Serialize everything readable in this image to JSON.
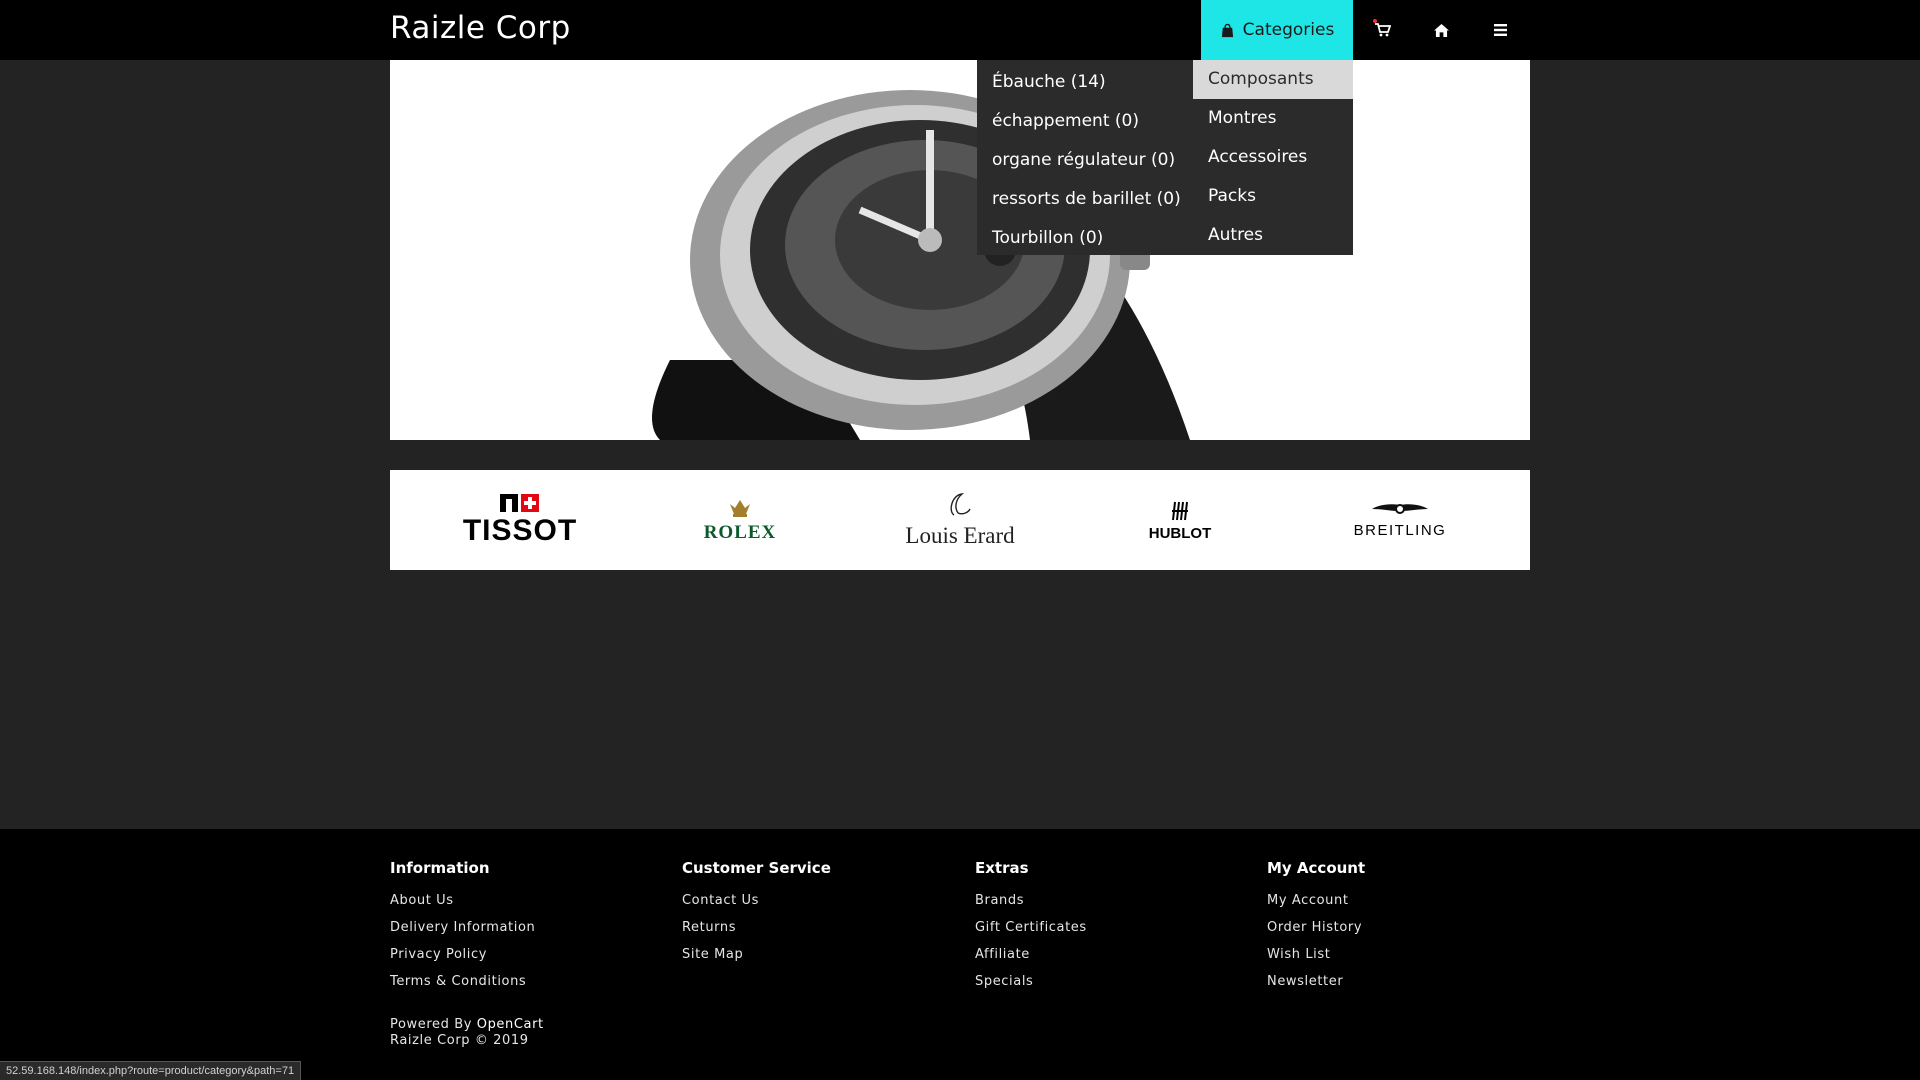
{
  "header": {
    "brand": "Raizle Corp",
    "categories_label": "Categories",
    "accent_color": "#1ee6e6"
  },
  "dropdown": {
    "main_items": [
      "Composants",
      "Montres",
      "Accessoires",
      "Packs",
      "Autres"
    ],
    "sub_items": [
      "Ébauche (14)",
      "échappement (0)",
      "organe régulateur (0)",
      "ressorts de barillet (0)",
      "Tourbillon (0)"
    ]
  },
  "brands": [
    "TISSOT",
    "ROLEX",
    "Louis Erard",
    "HUBLOT",
    "BREITLING"
  ],
  "footer": {
    "columns": [
      {
        "title": "Information",
        "links": [
          "About Us",
          "Delivery Information",
          "Privacy Policy",
          "Terms & Conditions"
        ]
      },
      {
        "title": "Customer Service",
        "links": [
          "Contact Us",
          "Returns",
          "Site Map"
        ]
      },
      {
        "title": "Extras",
        "links": [
          "Brands",
          "Gift Certificates",
          "Affiliate",
          "Specials"
        ]
      },
      {
        "title": "My Account",
        "links": [
          "My Account",
          "Order History",
          "Wish List",
          "Newsletter"
        ]
      }
    ],
    "powered_prefix": "Powered By ",
    "powered_link": "OpenCart",
    "copyright": "Raizle Corp © 2019"
  },
  "status_url": "52.59.168.148/index.php?route=product/category&path=71"
}
